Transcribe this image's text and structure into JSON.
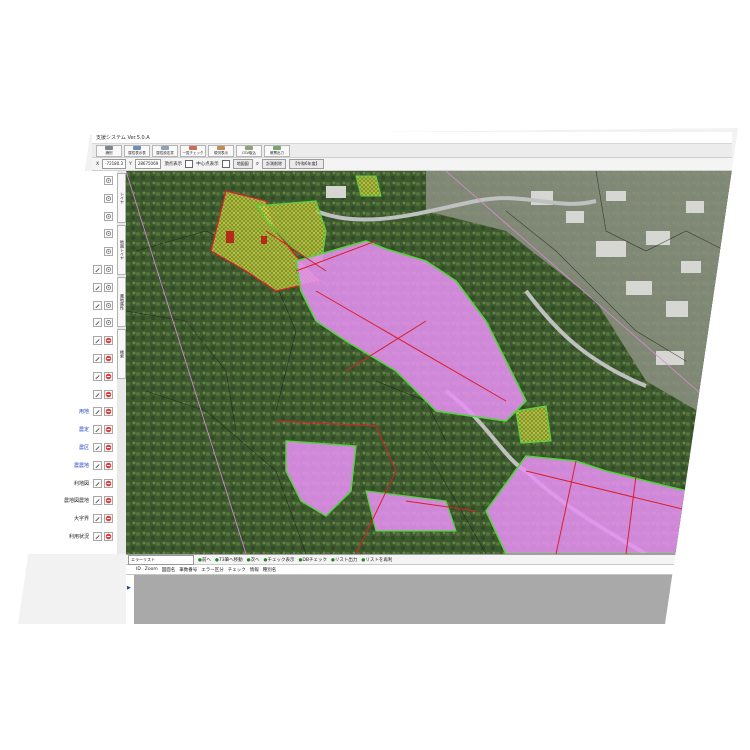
{
  "window": {
    "title": "支援システム Ver.5.0.A"
  },
  "toolbar": {
    "buttons": [
      {
        "label": "識別",
        "color": "#7d8590"
      },
      {
        "label": "属性表示表",
        "color": "#6d8eb5"
      },
      {
        "label": "属性設定書",
        "color": "#8fa1b6"
      },
      {
        "label": "一覧チェック",
        "color": "#c56e54"
      },
      {
        "label": "現況表示",
        "color": "#bd8d53"
      },
      {
        "label": "CSV取込",
        "color": "#8ba37a"
      },
      {
        "label": "帳票出力",
        "color": "#79a46b"
      }
    ]
  },
  "coordbar": {
    "x_label": "X",
    "x_value": "-72180.3",
    "y_label": "Y",
    "y_value": "28675069",
    "point_label": "頂点表示",
    "center_label": "中心点表示",
    "map_button": "地図図",
    "search_icon_label": "検索",
    "status_button": "計測削除",
    "year_button": "【令和6年度】"
  },
  "leftpanel": {
    "rows": [
      {
        "text": "",
        "blue": false
      },
      {
        "text": "",
        "blue": false
      },
      {
        "text": "",
        "blue": false
      },
      {
        "text": "",
        "blue": false
      },
      {
        "text": "",
        "blue": false
      },
      {
        "text": "",
        "blue": false
      },
      {
        "text": "",
        "blue": false
      },
      {
        "text": "",
        "blue": false
      },
      {
        "text": "",
        "blue": false
      },
      {
        "text": "",
        "blue": true
      },
      {
        "text": "",
        "blue": true
      },
      {
        "text": "",
        "blue": true
      },
      {
        "text": "",
        "blue": true
      },
      {
        "text": "用地",
        "blue": true
      },
      {
        "text": "農定",
        "blue": true
      },
      {
        "text": "農区",
        "blue": true
      },
      {
        "text": "農農地",
        "blue": true
      },
      {
        "text": "利地図",
        "blue": false
      },
      {
        "text": "農地図農地",
        "blue": false
      },
      {
        "text": "大字界",
        "blue": false
      },
      {
        "text": "利用状況",
        "blue": false
      }
    ]
  },
  "vtabs": [
    {
      "label": "レイヤ",
      "offset": 0
    },
    {
      "label": "地図レイヤ",
      "offset": 1
    },
    {
      "label": "農地属性",
      "offset": 2
    },
    {
      "label": "検索",
      "offset": 3
    }
  ],
  "errbar": {
    "select_value": "エラーリスト",
    "items": [
      "前へ",
      "73筆へ移動",
      "次へ",
      "チェック表示",
      "DBチェック",
      "リスト出力",
      "リストを再利"
    ]
  },
  "columns": [
    "ID",
    "Zoom",
    "図面名",
    "筆数番号",
    "エラー区分",
    "チェック",
    "情報",
    "種別名"
  ],
  "colors": {
    "farmland_fill": "#e58ff0",
    "farmland_border": "#52d43f",
    "parcel_line": "#d91f2a",
    "hatch_fill": "#d9e24a",
    "road": "#bfc0c0",
    "vegetation": "#3e5a2f"
  }
}
